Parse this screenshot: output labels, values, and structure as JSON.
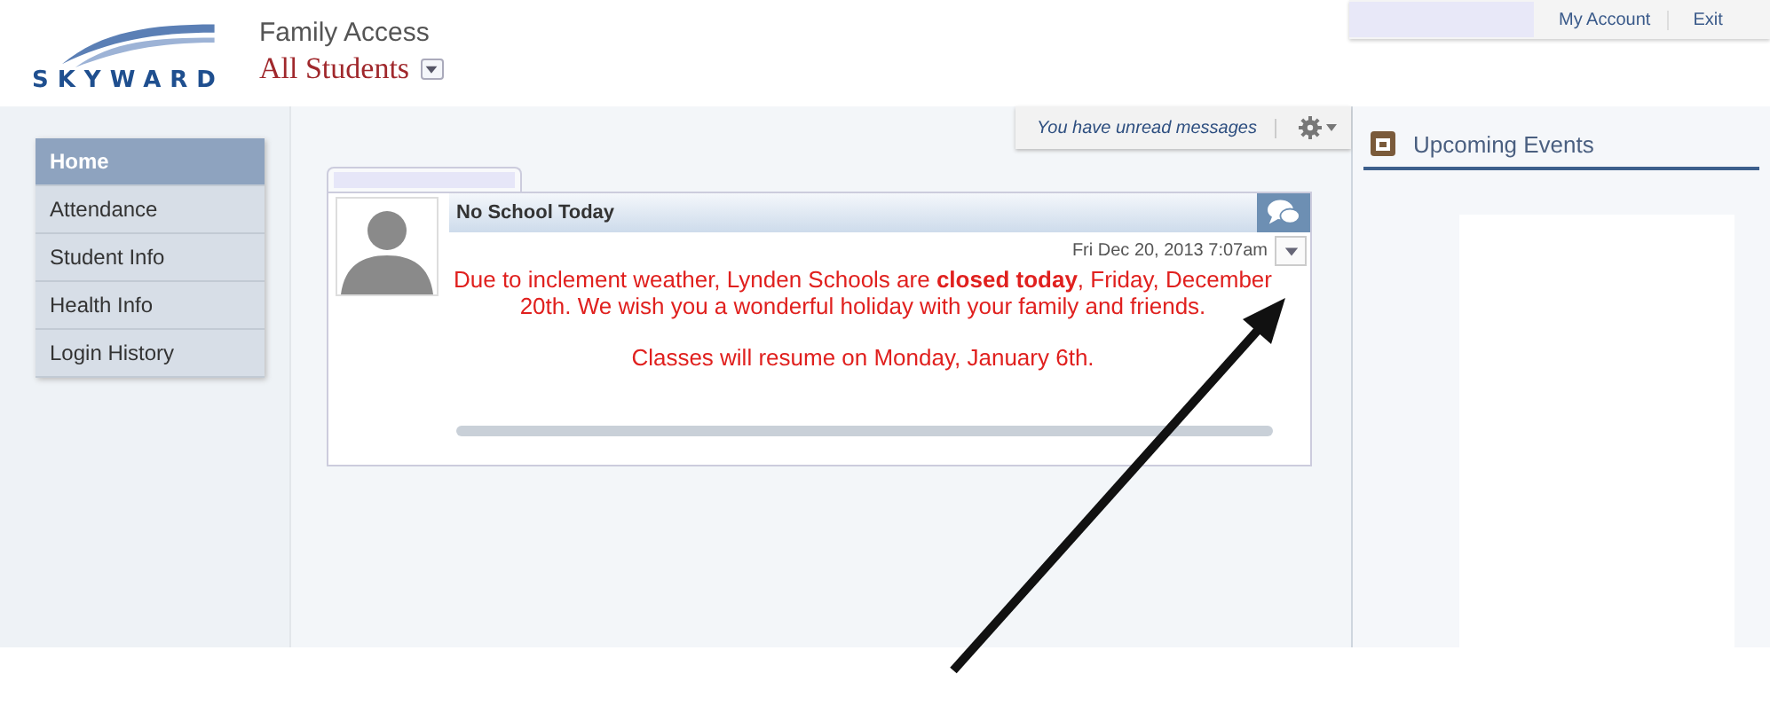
{
  "header": {
    "logo": "SKYWARD",
    "app_title": "Family Access",
    "student_selector": "All Students"
  },
  "top_links": [
    {
      "label": "My Account"
    },
    {
      "label": "Exit"
    }
  ],
  "sidebar": {
    "items": [
      {
        "label": "Home",
        "selected": true
      },
      {
        "label": "Attendance",
        "selected": false
      },
      {
        "label": "Student Info",
        "selected": false
      },
      {
        "label": "Health Info",
        "selected": false
      },
      {
        "label": "Login History",
        "selected": false
      }
    ]
  },
  "messages_bar": {
    "text": "You have unread messages"
  },
  "message": {
    "title": "No School Today",
    "date": "Fri Dec 20, 2013 7:07am",
    "body": "Due to inclement weather, Lynden Schools are **closed today**, Friday, December 20th.  We wish you a wonderful holiday with your family and friends.",
    "footer": "Classes will resume on Monday, January 6th."
  },
  "upcoming_events": {
    "title": "Upcoming Events"
  }
}
